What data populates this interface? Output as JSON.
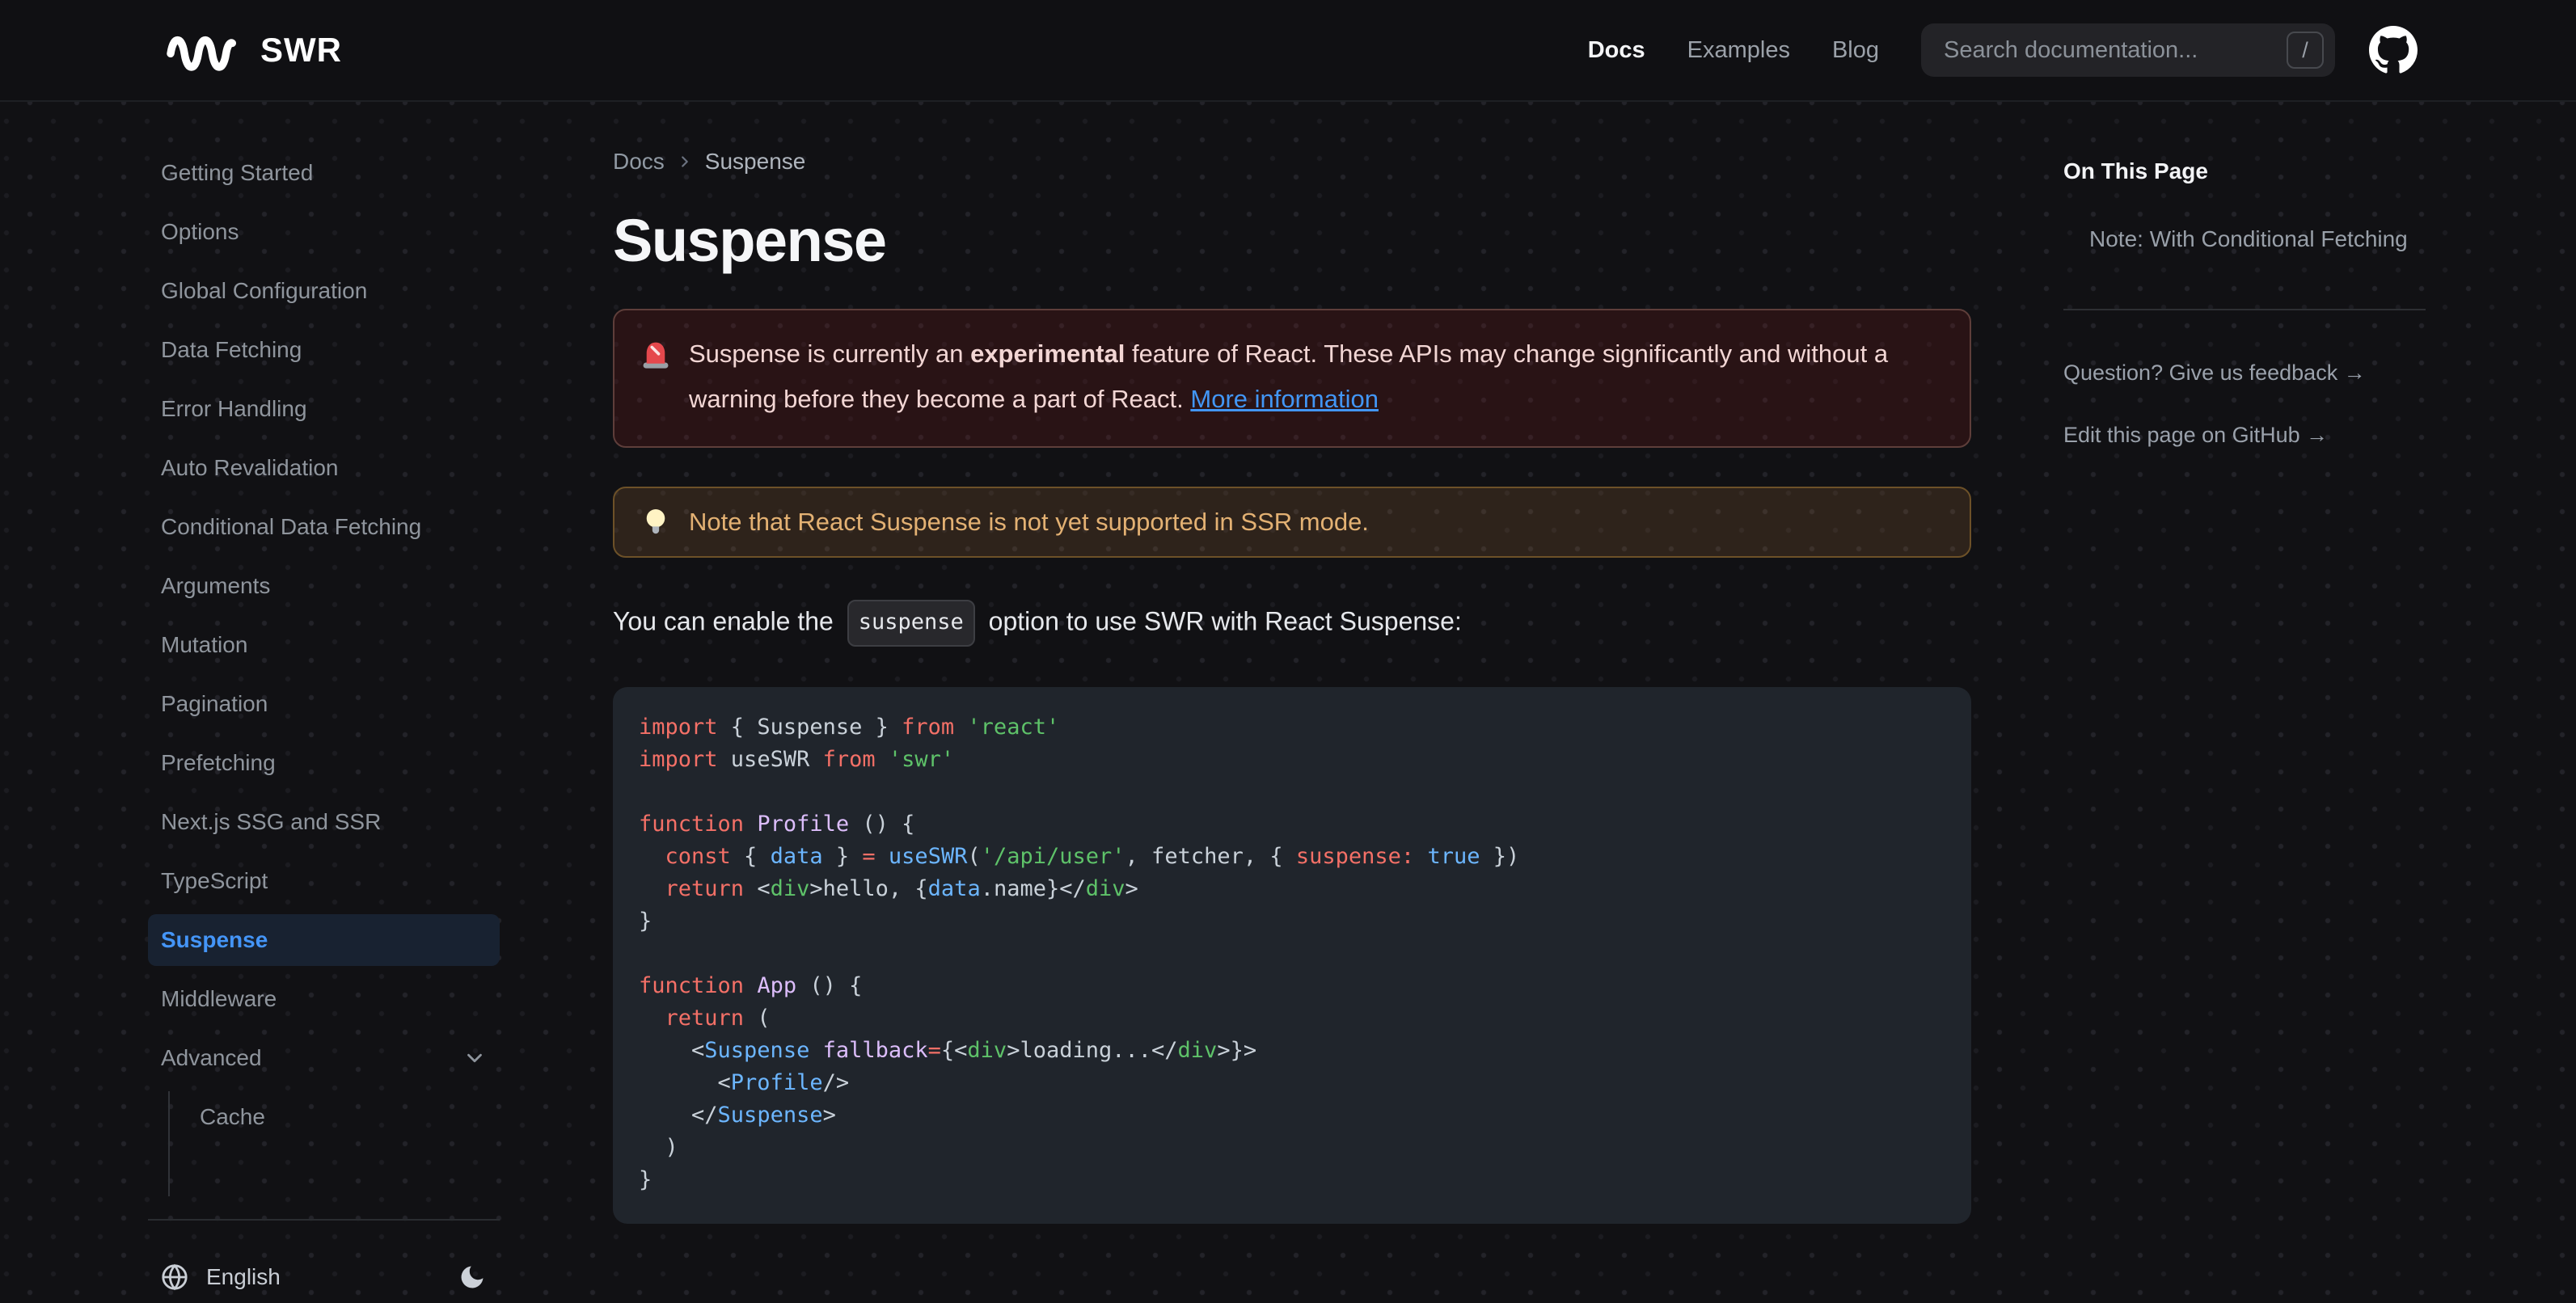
{
  "navbar": {
    "logo_text": "SWR",
    "links": [
      {
        "label": "Docs",
        "active": true
      },
      {
        "label": "Examples",
        "active": false
      },
      {
        "label": "Blog",
        "active": false
      }
    ],
    "search": {
      "placeholder": "Search documentation...",
      "shortcut": "/"
    }
  },
  "sidebar": {
    "items": [
      {
        "label": "Getting Started"
      },
      {
        "label": "Options"
      },
      {
        "label": "Global Configuration"
      },
      {
        "label": "Data Fetching"
      },
      {
        "label": "Error Handling"
      },
      {
        "label": "Auto Revalidation"
      },
      {
        "label": "Conditional Data Fetching"
      },
      {
        "label": "Arguments"
      },
      {
        "label": "Mutation"
      },
      {
        "label": "Pagination"
      },
      {
        "label": "Prefetching"
      },
      {
        "label": "Next.js SSG and SSR"
      },
      {
        "label": "TypeScript"
      },
      {
        "label": "Suspense",
        "active": true
      },
      {
        "label": "Middleware"
      },
      {
        "label": "Advanced",
        "chevron": true
      },
      {
        "label": "Cache",
        "nested": true
      }
    ],
    "footer": {
      "language": "English"
    }
  },
  "breadcrumb": {
    "section": "Docs",
    "page": "Suspense"
  },
  "page": {
    "title": "Suspense"
  },
  "callouts": {
    "error": {
      "icon": "siren-emoji",
      "segments": [
        {
          "t": "Suspense is currently an "
        },
        {
          "t": "experimental",
          "bold": true
        },
        {
          "t": " feature of React. These APIs may change significantly and without a warning before they become a part of React."
        }
      ],
      "link": "More information"
    },
    "warning": {
      "icon": "bulb-emoji",
      "text": "Note that React Suspense is not yet supported in SSR mode."
    }
  },
  "paragraph": {
    "segments": [
      {
        "t": "You can enable the "
      },
      {
        "t": "suspense",
        "code": true
      },
      {
        "t": " option to use SWR with React Suspense:"
      }
    ]
  },
  "code": {
    "lines": [
      [
        [
          "k",
          "import"
        ],
        [
          "p",
          " { Suspense } "
        ],
        [
          "k",
          "from"
        ],
        [
          "p",
          " "
        ],
        [
          "s",
          "'react'"
        ]
      ],
      [
        [
          "k",
          "import"
        ],
        [
          "p",
          " useSWR "
        ],
        [
          "k",
          "from"
        ],
        [
          "p",
          " "
        ],
        [
          "s",
          "'swr'"
        ]
      ],
      [],
      [
        [
          "k",
          "function"
        ],
        [
          "p",
          " "
        ],
        [
          "f",
          "Profile"
        ],
        [
          "p",
          " () {"
        ]
      ],
      [
        [
          "p",
          "  "
        ],
        [
          "k",
          "const"
        ],
        [
          "p",
          " { "
        ],
        [
          "b",
          "data"
        ],
        [
          "p",
          " } "
        ],
        [
          "k",
          "="
        ],
        [
          "p",
          " "
        ],
        [
          "b",
          "useSWR"
        ],
        [
          "p",
          "("
        ],
        [
          "s",
          "'/api/user'"
        ],
        [
          "p",
          ", fetcher, { "
        ],
        [
          "k",
          "suspense:"
        ],
        [
          "p",
          " "
        ],
        [
          "b",
          "true"
        ],
        [
          "p",
          " })"
        ]
      ],
      [
        [
          "p",
          "  "
        ],
        [
          "k",
          "return"
        ],
        [
          "p",
          " <"
        ],
        [
          "s",
          "div"
        ],
        [
          "p",
          ">hello, {"
        ],
        [
          "b",
          "data"
        ],
        [
          "p",
          ".name}</"
        ],
        [
          "s",
          "div"
        ],
        [
          "p",
          ">"
        ]
      ],
      [
        [
          "p",
          "}"
        ]
      ],
      [],
      [
        [
          "k",
          "function"
        ],
        [
          "p",
          " "
        ],
        [
          "f",
          "App"
        ],
        [
          "p",
          " () {"
        ]
      ],
      [
        [
          "p",
          "  "
        ],
        [
          "k",
          "return"
        ],
        [
          "p",
          " ("
        ]
      ],
      [
        [
          "p",
          "    <"
        ],
        [
          "b",
          "Suspense"
        ],
        [
          "p",
          " "
        ],
        [
          "f",
          "fallback"
        ],
        [
          "k",
          "="
        ],
        [
          "p",
          "{<"
        ],
        [
          "s",
          "div"
        ],
        [
          "p",
          ">loading...</"
        ],
        [
          "s",
          "div"
        ],
        [
          "p",
          ">}>"
        ]
      ],
      [
        [
          "p",
          "      <"
        ],
        [
          "b",
          "Profile"
        ],
        [
          "p",
          "/>"
        ]
      ],
      [
        [
          "p",
          "    </"
        ],
        [
          "b",
          "Suspense"
        ],
        [
          "p",
          ">"
        ]
      ],
      [
        [
          "p",
          "  )"
        ]
      ],
      [
        [
          "p",
          "}"
        ]
      ]
    ]
  },
  "toc": {
    "heading": "On This Page",
    "items": [
      "Note: With Conditional Fetching"
    ],
    "links": [
      "Question? Give us feedback →",
      "Edit this page on GitHub →"
    ]
  },
  "colors": {
    "accent_blue": "#4495f7",
    "active_item_bg": "#182231",
    "code_bg": "#20252c",
    "code_keyword": "#f47067",
    "code_string": "#5ec269",
    "code_blue": "#6cb6ff",
    "code_function": "#dcbdfb",
    "code_plain": "#c9d1d9",
    "error_border": "#5e3e3a",
    "error_text": "#f2d6d4",
    "warning_border": "#6d5128",
    "warning_text": "#e3b173",
    "link_blue": "#4296f5"
  }
}
